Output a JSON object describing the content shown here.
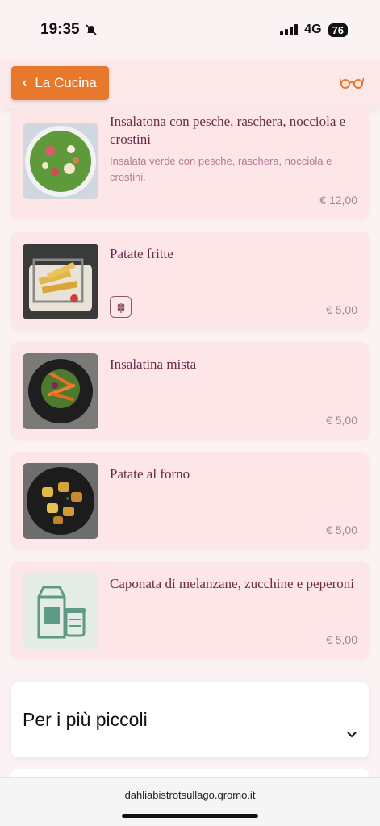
{
  "status": {
    "time": "19:35",
    "network": "4G",
    "battery": "76"
  },
  "nav": {
    "back_label": "La Cucina",
    "icon": "glasses-icon"
  },
  "items": [
    {
      "title": "Insalatona con pesche, raschera, nocciola e crostini",
      "description": "Insalata verde con pesche, raschera, nocciola e crostini.",
      "price": "€ 12,00"
    },
    {
      "title": "Patate fritte",
      "description": "",
      "price": "€ 5,00",
      "tag_icon": "wheat-icon"
    },
    {
      "title": "Insalatina mista",
      "description": "",
      "price": "€ 5,00"
    },
    {
      "title": "Patate al forno",
      "description": "",
      "price": "€ 5,00"
    },
    {
      "title": "Caponata di melanzane, zucchine e peperoni",
      "description": "",
      "price": "€ 5,00"
    }
  ],
  "section": {
    "title": "Per i più piccoli"
  },
  "browser": {
    "url": "dahliabistrotsullago.qromo.it"
  }
}
